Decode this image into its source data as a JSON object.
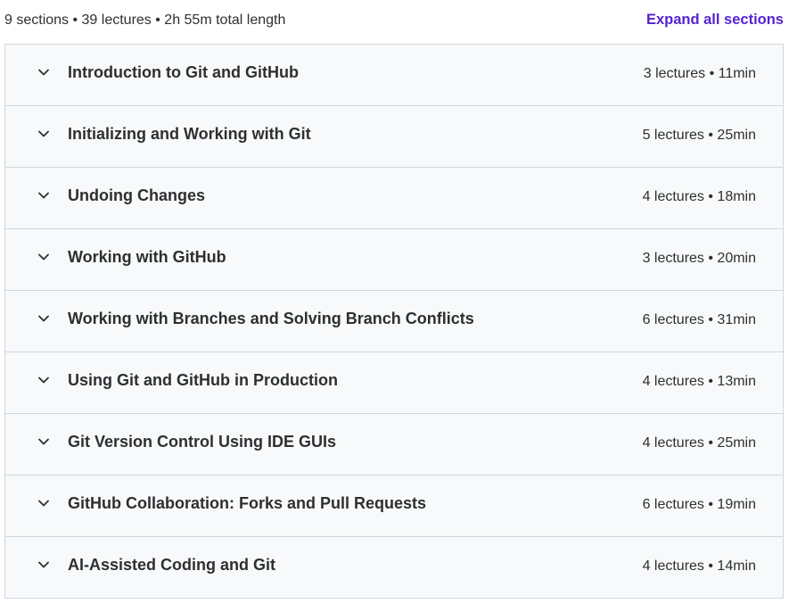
{
  "summary": {
    "text": "9 sections • 39 lectures • 2h 55m total length",
    "expand_label": "Expand all sections"
  },
  "colors": {
    "accent": "#5624d0",
    "row_background": "#f7f9fa",
    "border": "#d1d7dc",
    "text": "#2d2f31"
  },
  "icons": {
    "row_toggle": "chevron-down-icon"
  },
  "sections": [
    {
      "title": "Introduction to Git and GitHub",
      "meta": "3 lectures • 11min"
    },
    {
      "title": "Initializing and Working with Git",
      "meta": "5 lectures • 25min"
    },
    {
      "title": "Undoing Changes",
      "meta": "4 lectures • 18min"
    },
    {
      "title": "Working with GitHub",
      "meta": "3 lectures • 20min"
    },
    {
      "title": "Working with Branches and Solving Branch Conflicts",
      "meta": "6 lectures • 31min"
    },
    {
      "title": "Using Git and GitHub in Production",
      "meta": "4 lectures • 13min"
    },
    {
      "title": "Git Version Control Using IDE GUIs",
      "meta": "4 lectures • 25min"
    },
    {
      "title": "GitHub Collaboration: Forks and Pull Requests",
      "meta": "6 lectures • 19min"
    },
    {
      "title": "AI-Assisted Coding and Git",
      "meta": "4 lectures • 14min"
    }
  ]
}
